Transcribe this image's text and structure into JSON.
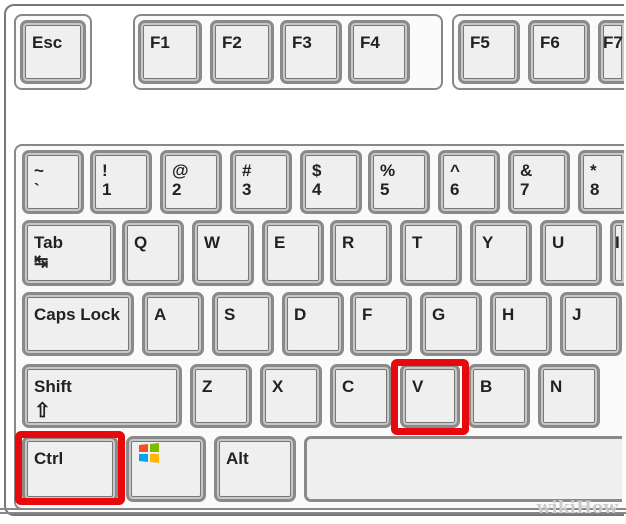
{
  "keyboard": {
    "function_row": [
      "Esc",
      "F1",
      "F2",
      "F3",
      "F4",
      "F5",
      "F6",
      "F7"
    ],
    "number_row": [
      [
        "~",
        "`"
      ],
      [
        "!",
        "1"
      ],
      [
        "@",
        "2"
      ],
      [
        "#",
        "3"
      ],
      [
        "$",
        "4"
      ],
      [
        "%",
        "5"
      ],
      [
        "^",
        "6"
      ],
      [
        "&",
        "7"
      ],
      [
        "*",
        "8"
      ]
    ],
    "tab_row": [
      "Tab",
      "Q",
      "W",
      "E",
      "R",
      "T",
      "Y",
      "U",
      "I"
    ],
    "caps_row": [
      "Caps Lock",
      "A",
      "S",
      "D",
      "F",
      "G",
      "H",
      "J"
    ],
    "shift_row": [
      "Shift",
      "Z",
      "X",
      "C",
      "V",
      "B",
      "N"
    ],
    "bottom_row": [
      "Ctrl",
      "",
      "Alt"
    ],
    "shift_symbol": "⇧",
    "tab_symbol": "↹"
  },
  "highlighted_keys": [
    "Ctrl",
    "V"
  ],
  "highlight_color": "#e8090d",
  "watermark": "wikiHow"
}
